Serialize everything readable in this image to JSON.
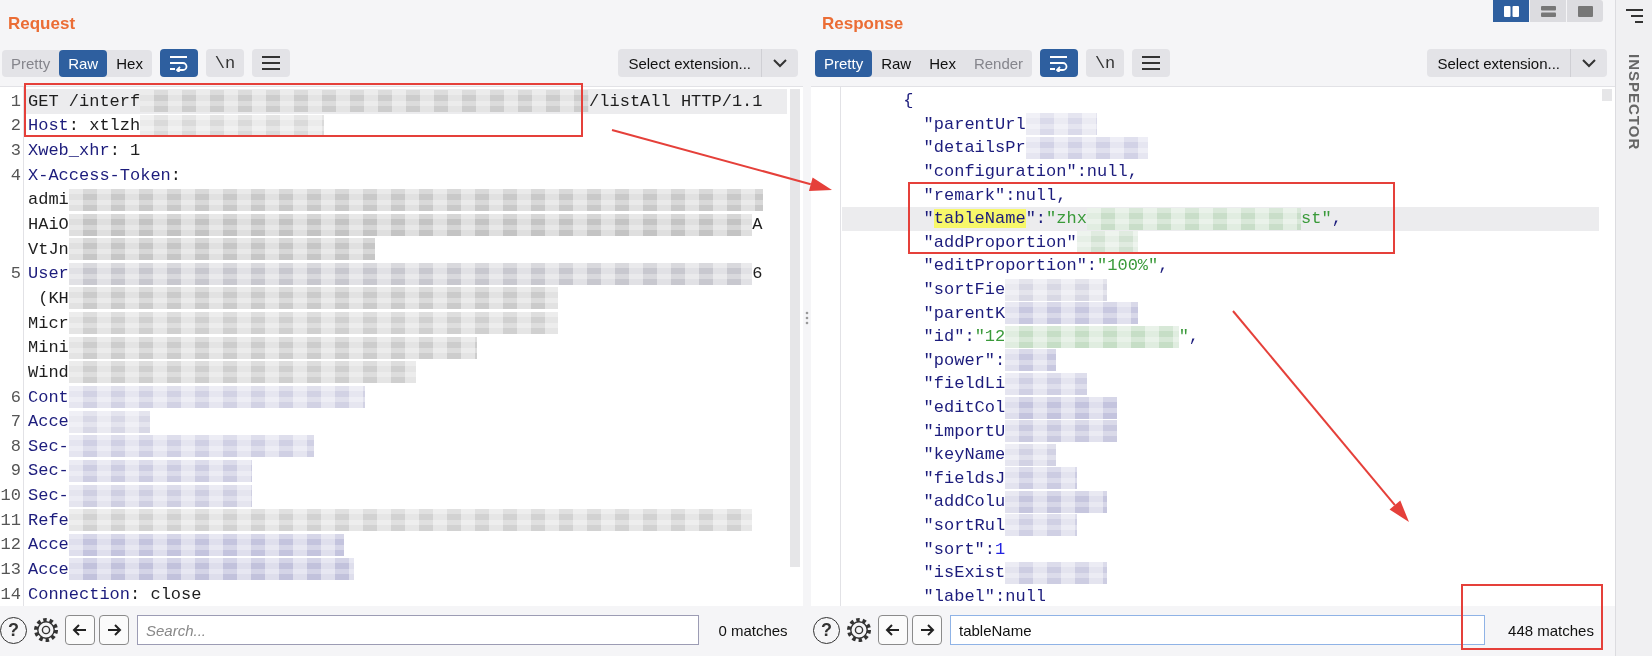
{
  "request": {
    "title": "Request",
    "views": [
      {
        "label": "Pretty",
        "selected": false,
        "disabled": true
      },
      {
        "label": "Raw",
        "selected": true,
        "disabled": false
      },
      {
        "label": "Hex",
        "selected": false,
        "disabled": false
      }
    ],
    "buttons": [
      {
        "kind": "wrap",
        "on": true
      },
      {
        "kind": "newlines",
        "label": "\\n",
        "on": false
      },
      {
        "kind": "menu",
        "on": false
      }
    ],
    "extension": "Select extension...",
    "lines": [
      {
        "number": "1",
        "current": true,
        "segments": [
          {
            "kind": "plain",
            "text": "GET /interf"
          },
          {
            "kind": "mosaic",
            "color": "#cdcdcd"
          },
          {
            "kind": "plain",
            "text": "/listAll HTTP/1.1"
          }
        ]
      },
      {
        "number": "2",
        "current": false,
        "segments": [
          {
            "kind": "name",
            "text": "Host"
          },
          {
            "kind": "plain",
            "text": ": xtlzh"
          },
          {
            "kind": "mosaic",
            "color": "#dadada"
          }
        ]
      },
      {
        "number": "3",
        "current": false,
        "segments": [
          {
            "kind": "name",
            "text": "Xweb_xhr"
          },
          {
            "kind": "plain",
            "text": ": 1"
          }
        ]
      },
      {
        "number": "4",
        "current": false,
        "segments": [
          {
            "kind": "name",
            "text": "X-Access-Token"
          },
          {
            "kind": "plain",
            "text": ":"
          }
        ]
      },
      {
        "current": false,
        "segments": [
          {
            "kind": "plain",
            "text": "admi"
          },
          {
            "kind": "mosaic",
            "color": "#c9c9c9"
          }
        ]
      },
      {
        "current": false,
        "segments": [
          {
            "kind": "plain",
            "text": "HAiO"
          },
          {
            "kind": "mosaic",
            "color": "#c4c4c4"
          },
          {
            "kind": "plain",
            "text": "A"
          }
        ]
      },
      {
        "current": false,
        "segments": [
          {
            "kind": "plain",
            "text": "VtJn"
          },
          {
            "kind": "mosaic",
            "color": "#c6c6c6"
          }
        ]
      },
      {
        "number": "5",
        "current": false,
        "segments": [
          {
            "kind": "name",
            "text": "User"
          },
          {
            "kind": "mosaic",
            "color": "#c8c8cf"
          },
          {
            "kind": "plain",
            "text": "6"
          }
        ]
      },
      {
        "current": false,
        "segments": [
          {
            "kind": "plain",
            "text": " (KH"
          },
          {
            "kind": "mosaic",
            "color": "#cbcbcb"
          }
        ]
      },
      {
        "current": false,
        "segments": [
          {
            "kind": "plain",
            "text": "Micr"
          },
          {
            "kind": "mosaic",
            "color": "#d0d0d0"
          }
        ]
      },
      {
        "current": false,
        "segments": [
          {
            "kind": "plain",
            "text": "Mini"
          },
          {
            "kind": "mosaic",
            "color": "#cdcdcd"
          }
        ]
      },
      {
        "current": false,
        "segments": [
          {
            "kind": "plain",
            "text": "Wind"
          },
          {
            "kind": "mosaic",
            "color": "#cfcfcf"
          }
        ]
      },
      {
        "number": "6",
        "current": false,
        "segments": [
          {
            "kind": "name",
            "text": "Cont"
          },
          {
            "kind": "mosaic",
            "color": "#d2d2e4"
          }
        ]
      },
      {
        "number": "7",
        "current": false,
        "segments": [
          {
            "kind": "name",
            "text": "Acce"
          },
          {
            "kind": "mosaic",
            "color": "#d8d8e6"
          }
        ]
      },
      {
        "number": "8",
        "current": false,
        "segments": [
          {
            "kind": "name",
            "text": "Sec-"
          },
          {
            "kind": "mosaic",
            "color": "#d0d0e4"
          }
        ]
      },
      {
        "number": "9",
        "current": false,
        "segments": [
          {
            "kind": "name",
            "text": "Sec-"
          },
          {
            "kind": "mosaic",
            "color": "#cdcde2"
          }
        ]
      },
      {
        "number": "10",
        "current": false,
        "segments": [
          {
            "kind": "name",
            "text": "Sec-"
          },
          {
            "kind": "mosaic",
            "color": "#cfcfe2"
          }
        ]
      },
      {
        "number": "11",
        "current": false,
        "segments": [
          {
            "kind": "name",
            "text": "Refe"
          },
          {
            "kind": "mosaic",
            "color": "#d2d2d2"
          }
        ]
      },
      {
        "number": "12",
        "current": false,
        "segments": [
          {
            "kind": "name",
            "text": "Acce"
          },
          {
            "kind": "mosaic",
            "color": "#c4c4de"
          }
        ]
      },
      {
        "number": "13",
        "current": false,
        "segments": [
          {
            "kind": "name",
            "text": "Acce"
          },
          {
            "kind": "mosaic",
            "color": "#c2c2dc"
          }
        ]
      },
      {
        "number": "14",
        "current": false,
        "segments": [
          {
            "kind": "name",
            "text": "Connection"
          },
          {
            "kind": "plain",
            "text": ": close"
          }
        ]
      }
    ],
    "search": {
      "help": "?",
      "placeholder": "Search...",
      "matches": "0 matches",
      "focused": false
    }
  },
  "layout_options": [
    {
      "kind": "side-by-side",
      "selected": true
    },
    {
      "kind": "stacked",
      "selected": false
    },
    {
      "kind": "single",
      "selected": false
    }
  ],
  "response": {
    "title": "Response",
    "views": [
      {
        "label": "Pretty",
        "selected": true,
        "disabled": false
      },
      {
        "label": "Raw",
        "selected": false,
        "disabled": false
      },
      {
        "label": "Hex",
        "selected": false,
        "disabled": false
      },
      {
        "label": "Render",
        "selected": false,
        "disabled": true
      }
    ],
    "buttons": [
      {
        "kind": "wrap",
        "on": true
      },
      {
        "kind": "newlines",
        "label": "\\n",
        "on": false
      },
      {
        "kind": "menu",
        "on": false
      }
    ],
    "extension": "Select extension...",
    "lines": [
      {
        "kind": "open",
        "current": false,
        "segments": [
          {
            "kind": "punct",
            "text": "{"
          }
        ]
      },
      {
        "kind": "member",
        "current": false,
        "segments": [
          {
            "kind": "key",
            "text": "\"parentUrl"
          },
          {
            "kind": "mosaic",
            "color": "#dadaea"
          }
        ]
      },
      {
        "kind": "member",
        "current": false,
        "segments": [
          {
            "kind": "key",
            "text": "\"detailsPr"
          },
          {
            "kind": "mosaic",
            "color": "#d2d2e6"
          }
        ]
      },
      {
        "kind": "member",
        "current": false,
        "segments": [
          {
            "kind": "key",
            "text": "\"configuration\""
          },
          {
            "kind": "punct",
            "text": ":null,"
          }
        ]
      },
      {
        "kind": "member",
        "current": false,
        "segments": [
          {
            "kind": "key",
            "text": "\"remark\""
          },
          {
            "kind": "punct",
            "text": ":null,"
          }
        ]
      },
      {
        "kind": "member",
        "current": true,
        "segments": [
          {
            "kind": "key",
            "text": "\""
          },
          {
            "kind": "match",
            "text": "tableName"
          },
          {
            "kind": "key",
            "text": "\""
          },
          {
            "kind": "punct",
            "text": ":"
          },
          {
            "kind": "str",
            "text": "\"zhx"
          },
          {
            "kind": "mosaic",
            "color": "#c9dec9"
          },
          {
            "kind": "str",
            "text": "st\""
          },
          {
            "kind": "punct",
            "text": ","
          }
        ]
      },
      {
        "kind": "member",
        "current": false,
        "segments": [
          {
            "kind": "key",
            "text": "\"addProportion\""
          },
          {
            "kind": "mosaic",
            "color": "#d2e2d2"
          }
        ]
      },
      {
        "kind": "member",
        "current": false,
        "segments": [
          {
            "kind": "key",
            "text": "\"editProportion\""
          },
          {
            "kind": "punct",
            "text": ":"
          },
          {
            "kind": "str",
            "text": "\"100%\""
          },
          {
            "kind": "punct",
            "text": ","
          }
        ]
      },
      {
        "kind": "member",
        "current": false,
        "segments": [
          {
            "kind": "key",
            "text": "\"sortFie"
          },
          {
            "kind": "mosaic",
            "color": "#d8d8e4"
          }
        ]
      },
      {
        "kind": "member",
        "current": false,
        "segments": [
          {
            "kind": "key",
            "text": "\"parentK"
          },
          {
            "kind": "mosaic",
            "color": "#c8c8e0"
          }
        ]
      },
      {
        "kind": "member",
        "current": false,
        "segments": [
          {
            "kind": "key",
            "text": "\"id\""
          },
          {
            "kind": "punct",
            "text": ":"
          },
          {
            "kind": "str",
            "text": "\"12"
          },
          {
            "kind": "mosaic",
            "color": "#c6dec6"
          },
          {
            "kind": "str",
            "text": "\""
          },
          {
            "kind": "punct",
            "text": ","
          }
        ]
      },
      {
        "kind": "member",
        "current": false,
        "segments": [
          {
            "kind": "key",
            "text": "\"power\""
          },
          {
            "kind": "punct",
            "text": ":"
          },
          {
            "kind": "mosaic",
            "color": "#c8c8e0"
          }
        ]
      },
      {
        "kind": "member",
        "current": false,
        "segments": [
          {
            "kind": "key",
            "text": "\"fieldLi"
          },
          {
            "kind": "mosaic",
            "color": "#d0d0e4"
          }
        ]
      },
      {
        "kind": "member",
        "current": false,
        "segments": [
          {
            "kind": "key",
            "text": "\"editCol"
          },
          {
            "kind": "mosaic",
            "color": "#c4c4de"
          }
        ]
      },
      {
        "kind": "member",
        "current": false,
        "segments": [
          {
            "kind": "key",
            "text": "\"importU"
          },
          {
            "kind": "mosaic",
            "color": "#cacae0"
          }
        ]
      },
      {
        "kind": "member",
        "current": false,
        "segments": [
          {
            "kind": "key",
            "text": "\"keyName"
          },
          {
            "kind": "mosaic",
            "color": "#d2d2e4"
          }
        ]
      },
      {
        "kind": "member",
        "current": false,
        "segments": [
          {
            "kind": "key",
            "text": "\"fieldsJ"
          },
          {
            "kind": "mosaic",
            "color": "#ccccE2"
          }
        ]
      },
      {
        "kind": "member",
        "current": false,
        "segments": [
          {
            "kind": "key",
            "text": "\"addColu"
          },
          {
            "kind": "mosaic",
            "color": "#c6c6de"
          }
        ]
      },
      {
        "kind": "member",
        "current": false,
        "segments": [
          {
            "kind": "key",
            "text": "\"sortRul"
          },
          {
            "kind": "mosaic",
            "color": "#d0d0e4"
          }
        ]
      },
      {
        "kind": "member",
        "current": false,
        "segments": [
          {
            "kind": "key",
            "text": "\"sort\""
          },
          {
            "kind": "punct",
            "text": ":"
          },
          {
            "kind": "num",
            "text": "1"
          }
        ]
      },
      {
        "kind": "member",
        "current": false,
        "segments": [
          {
            "kind": "key",
            "text": "\"isExist"
          },
          {
            "kind": "mosaic",
            "color": "#cdcde2"
          }
        ]
      },
      {
        "kind": "member",
        "current": false,
        "segments": [
          {
            "kind": "key",
            "text": "\"label\""
          },
          {
            "kind": "punct",
            "text": ":null"
          }
        ]
      }
    ],
    "search": {
      "help": "?",
      "value": "tableName",
      "matches": "448 matches",
      "focused": true
    }
  },
  "inspector": {
    "label": "INSPECTOR"
  },
  "annotations": [
    {
      "kind": "box"
    },
    {
      "kind": "arrow"
    },
    {
      "kind": "box"
    },
    {
      "kind": "arrow"
    },
    {
      "kind": "box"
    }
  ]
}
